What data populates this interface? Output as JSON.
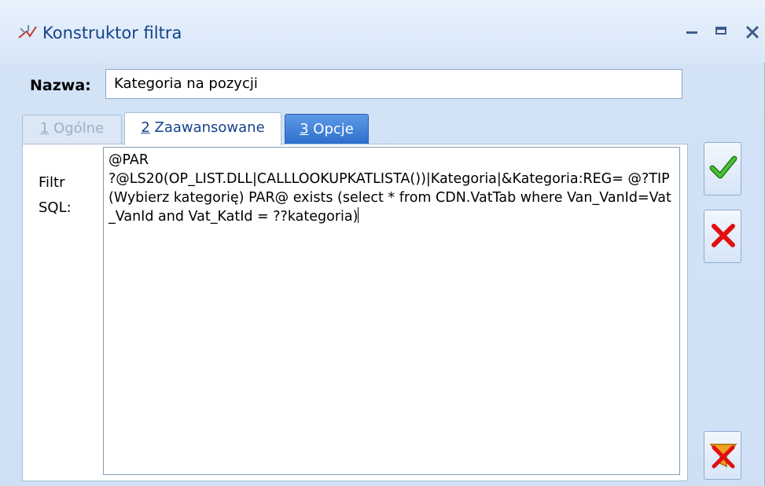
{
  "window": {
    "title": "Konstruktor filtra"
  },
  "name_field": {
    "label": "Nazwa:",
    "value": "Kategoria na pozycji"
  },
  "tabs": [
    {
      "number": "1",
      "label": " Ogólne",
      "state": "disabled"
    },
    {
      "number": "2",
      "label": " Zaawansowane",
      "state": "active"
    },
    {
      "number": "3",
      "label": " Opcje",
      "state": "highlighted"
    }
  ],
  "filter": {
    "label": "Filtr SQL:",
    "sql": "@PAR\n?@LS20(OP_LIST.DLL|CALLLOOKUPKATLISTA())|Kategoria|&Kategoria:REG= @?TIP(Wybierz kategorię) PAR@ exists (select * from CDN.VatTab where Van_VanId=Vat_VanId and Vat_KatId = ??kategoria)"
  },
  "colors": {
    "accent": "#15428b",
    "ok_green": "#2e9a1e",
    "cancel_red": "#e01010",
    "funnel_orange": "#f0a020"
  },
  "icons": {
    "title": "filter-constructor-icon",
    "ok": "checkmark-icon",
    "cancel": "x-mark-icon",
    "clear": "funnel-clear-icon"
  }
}
